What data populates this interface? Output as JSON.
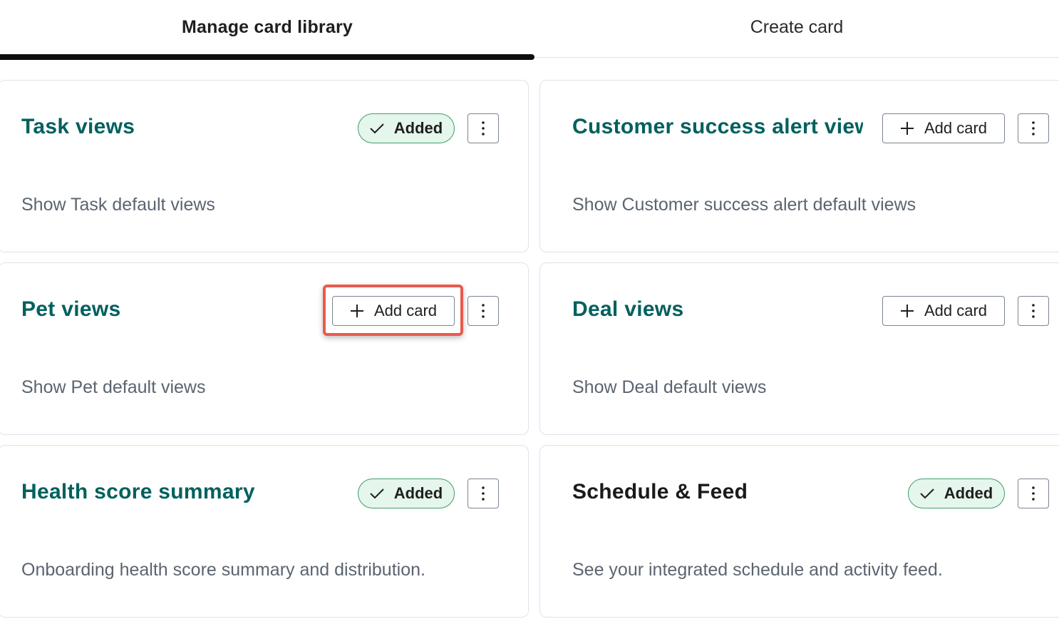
{
  "tabs": {
    "manage_label": "Manage card library",
    "create_label": "Create card"
  },
  "cards": [
    {
      "title": "Task views",
      "description": "Show Task default views",
      "status": "Added"
    },
    {
      "title": "Customer success alert views",
      "description": "Show Customer success alert default views",
      "status": "Add card"
    },
    {
      "title": "Pet views",
      "description": "Show Pet default views",
      "status": "Add card"
    },
    {
      "title": "Deal views",
      "description": "Show Deal default views",
      "status": "Add card"
    },
    {
      "title": "Health score summary",
      "description": "Onboarding health score summary and distribution.",
      "status": "Added"
    },
    {
      "title": "Schedule & Feed",
      "description": "See your integrated schedule and activity feed.",
      "status": "Added"
    }
  ],
  "labels": {
    "added": "Added",
    "add_card": "Add card"
  },
  "icons": {
    "added": "check-icon",
    "add": "plus-icon",
    "more": "more-vertical-icon"
  },
  "colors": {
    "title_teal": "#00605e",
    "added_bg": "#e5f6ec",
    "added_border": "#3f9e6a",
    "highlight": "#ea5a4d"
  }
}
